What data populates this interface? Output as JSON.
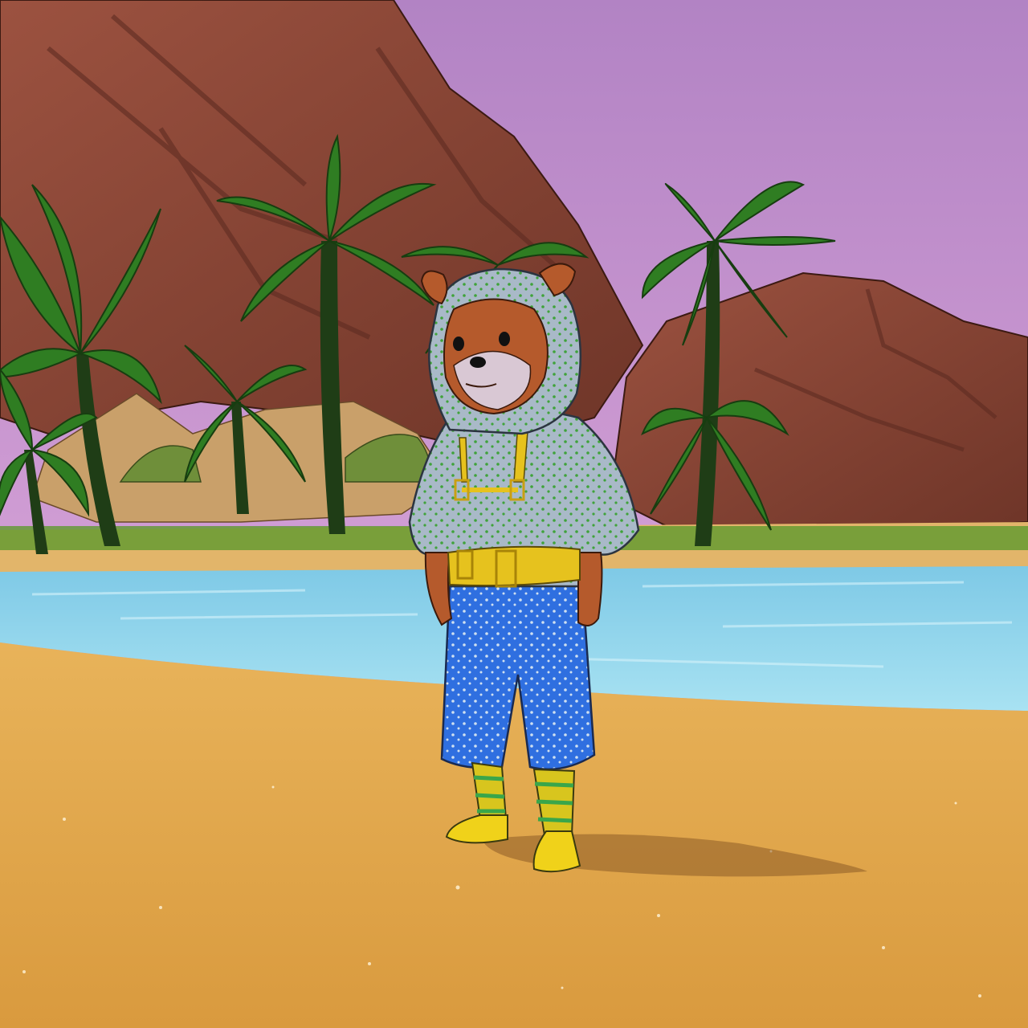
{
  "scene": {
    "sky_color": "#c48ccc",
    "sky_top_color": "#b283c4",
    "rock_color": "#8e4a38",
    "rock_shadow_color": "#5e2c22",
    "sand_color": "#e0a84a",
    "water_color": "#8fd6ec",
    "palm_leaf_color": "#2f7d22",
    "palm_trunk_color": "#1f3d16"
  },
  "character": {
    "kind": "bear",
    "fur_color": "#b55a2c",
    "muzzle_color": "#d9c8d4",
    "hoodie_color": "#a9b9c8",
    "hoodie_dot_color": "#3fa33a",
    "pants_color": "#2f6fe0",
    "pants_dot_color": "#cfe0f0",
    "strap_color": "#e6c21e",
    "sock_color": "#d8c51e",
    "sock_stripe_color": "#3aa64a",
    "shoe_color": "#f0d21a"
  }
}
